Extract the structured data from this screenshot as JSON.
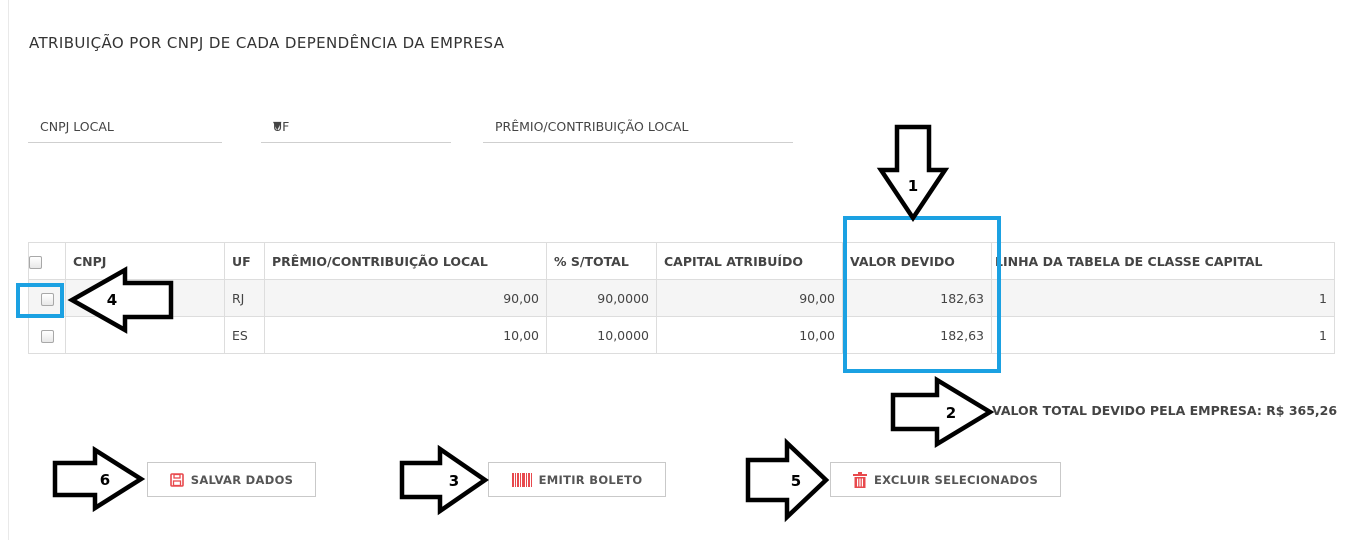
{
  "title": "ATRIBUIÇÃO POR CNPJ DE CADA DEPENDÊNCIA DA EMPRESA",
  "fields": {
    "cnpj_local": "CNPJ LOCAL",
    "uf": "UF",
    "uf_caret": "▼",
    "premio_local": "PRÊMIO/CONTRIBUIÇÃO LOCAL"
  },
  "table": {
    "headers": {
      "cnpj": "CNPJ",
      "uf": "UF",
      "premio": "PRÊMIO/CONTRIBUIÇÃO LOCAL",
      "percent": "% S/TOTAL",
      "capital": "CAPITAL ATRIBUÍDO",
      "valor": "VALOR DEVIDO",
      "linha": "LINHA DA TABELA DE CLASSE CAPITAL"
    },
    "rows": [
      {
        "cnpj": "",
        "uf": "RJ",
        "premio": "90,00",
        "percent": "90,0000",
        "capital": "90,00",
        "valor": "182,63",
        "linha": "1"
      },
      {
        "cnpj": "",
        "uf": "ES",
        "premio": "10,00",
        "percent": "10,0000",
        "capital": "10,00",
        "valor": "182,63",
        "linha": "1"
      }
    ]
  },
  "total_label": "VALOR TOTAL DEVIDO PELA EMPRESA: R$ 365,26",
  "buttons": {
    "save": "SALVAR DADOS",
    "boleto": "EMITIR BOLETO",
    "delete": "EXCLUIR SELECIONADOS"
  },
  "annotations": {
    "n1": "1",
    "n2": "2",
    "n3": "3",
    "n4": "4",
    "n5": "5",
    "n6": "6",
    "highlight_color": "#1ba1e2"
  },
  "icons": {
    "save": "floppy-disk-icon",
    "boleto": "barcode-icon",
    "delete": "trash-icon",
    "uf_caret": "dropdown-caret-icon"
  },
  "colors": {
    "icon_red": "#e8494d",
    "highlight": "#1ba1e2"
  }
}
